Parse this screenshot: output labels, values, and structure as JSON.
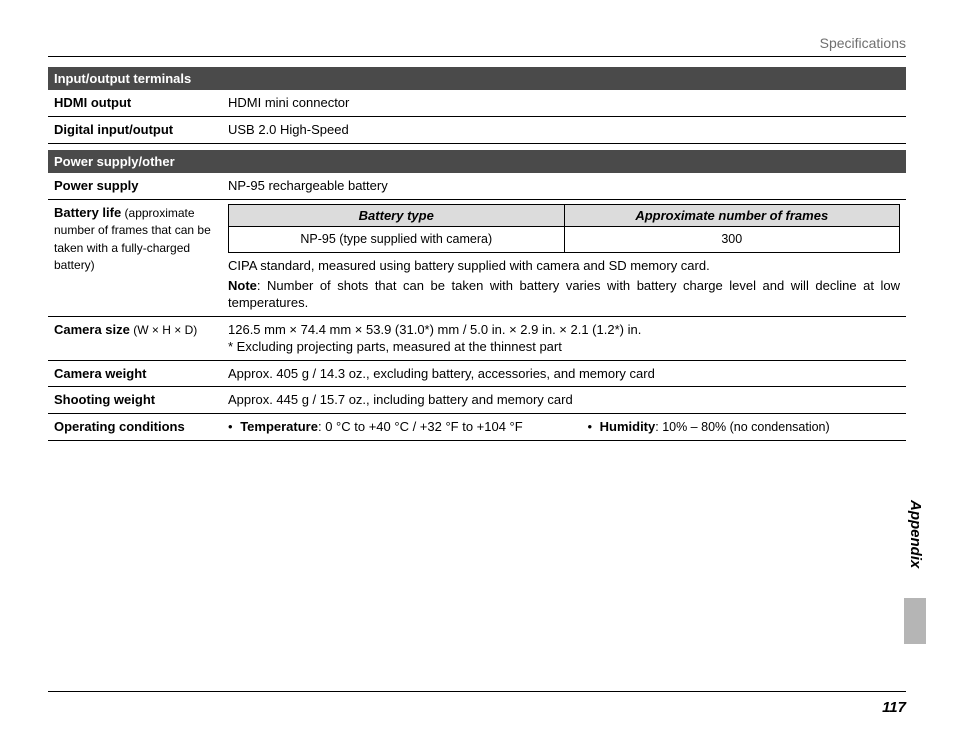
{
  "runningHead": "Specifications",
  "sections": {
    "io": {
      "title": "Input/output terminals",
      "rows": {
        "hdmi": {
          "label": "HDMI output",
          "value": "HDMI mini connector"
        },
        "digital": {
          "label": "Digital input/output",
          "value": "USB 2.0 High-Speed"
        }
      }
    },
    "power": {
      "title": "Power supply/other",
      "supply": {
        "label": "Power supply",
        "value": "NP-95 rechargeable battery"
      },
      "battery": {
        "label": "Battery life",
        "paren": " (approximate number of frames that can be taken with a fully-charged battery)",
        "table": {
          "head": {
            "type": "Battery type",
            "frames": "Approximate number of frames"
          },
          "row": {
            "type": "NP-95  (type supplied with camera)",
            "frames": "300"
          }
        },
        "cipa": "CIPA standard, measured using battery supplied with camera and SD memory card.",
        "noteLabel": "Note",
        "note": ": Number of shots that can be taken with battery varies with battery charge level and will decline at low temperatures."
      },
      "size": {
        "label": "Camera size",
        "paren": " (W × H × D)",
        "value": "126.5 mm × 74.4 mm × 53.9 (31.0*) mm / 5.0 in. × 2.9 in. × 2.1 (1.2*) in.",
        "foot": "* Excluding projecting parts, measured at the thinnest part"
      },
      "weight": {
        "label": "Camera weight",
        "value": "Approx. 405 g / 14.3 oz., excluding battery, accessories, and memory card"
      },
      "shoot": {
        "label": "Shooting weight",
        "value": "Approx. 445 g / 15.7 oz., including battery and memory card"
      },
      "cond": {
        "label": "Operating conditions",
        "tempLabel": "Temperature",
        "tempValue": ": 0 °C to +40 °C / +32 °F to +104 °F",
        "humLabel": "Humidity",
        "humValue": ": 10% – 80% (no condensation)"
      }
    }
  },
  "tab": "Appendix",
  "pageNumber": "117"
}
